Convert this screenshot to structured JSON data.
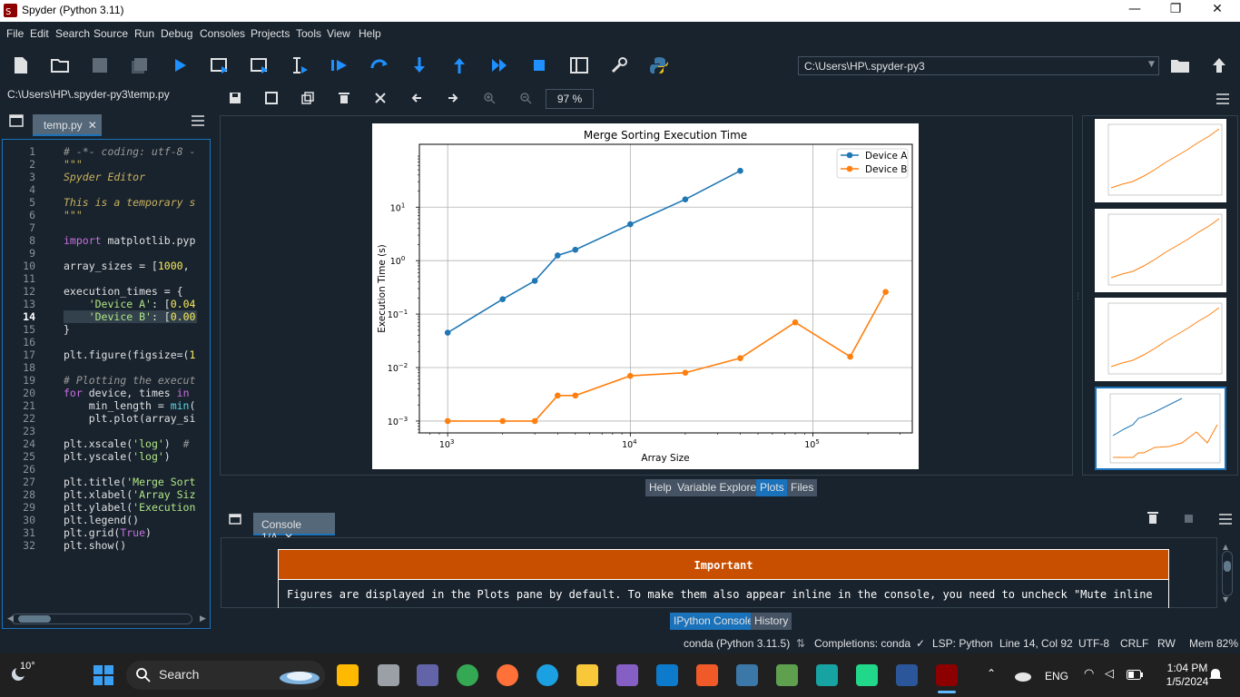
{
  "window": {
    "title": "Spyder (Python 3.11)"
  },
  "menu": [
    "File",
    "Edit",
    "Search",
    "Source",
    "Run",
    "Debug",
    "Consoles",
    "Projects",
    "Tools",
    "View",
    "Help"
  ],
  "toolbar": {
    "working_dir": "C:\\Users\\HP\\.spyder-py3"
  },
  "editor": {
    "path": "C:\\Users\\HP\\.spyder-py3\\temp.py",
    "tab": "temp.py",
    "current_line": 14,
    "lines": [
      "# -*- coding: utf-8 -",
      "\"\"\"",
      "Spyder Editor",
      "",
      "This is a temporary s",
      "\"\"\"",
      "",
      "import matplotlib.pyp",
      "",
      "array_sizes = [1000,",
      "",
      "execution_times = {",
      "    'Device A': [0.04",
      "    'Device B': [0.00",
      "}",
      "",
      "plt.figure(figsize=(1",
      "",
      "# Plotting the execut",
      "for device, times in",
      "    min_length = min(",
      "    plt.plot(array_si",
      "",
      "plt.xscale('log')  #",
      "plt.yscale('log')",
      "",
      "plt.title('Merge Sort",
      "plt.xlabel('Array Siz",
      "plt.ylabel('Execution",
      "plt.legend()",
      "plt.grid(True)",
      "plt.show()"
    ]
  },
  "plots": {
    "zoom": "97 %",
    "tabs": [
      "Help",
      "Variable Explorer",
      "Plots",
      "Files"
    ],
    "active_tab": "Plots"
  },
  "chart_data": {
    "type": "line",
    "title": "Merge Sorting Execution Time",
    "xlabel": "Array Size",
    "ylabel": "Execution Time (s)",
    "xscale": "log",
    "yscale": "log",
    "xlim": [
      700,
      350000
    ],
    "ylim": [
      0.0006,
      150
    ],
    "xticks": [
      {
        "v": 1000,
        "base": "10",
        "exp": "3"
      },
      {
        "v": 10000,
        "base": "10",
        "exp": "4"
      },
      {
        "v": 100000,
        "base": "10",
        "exp": "5"
      }
    ],
    "yticks": [
      {
        "v": 0.001,
        "base": "10",
        "exp": "−3"
      },
      {
        "v": 0.01,
        "base": "10",
        "exp": "−2"
      },
      {
        "v": 0.1,
        "base": "10",
        "exp": "−1"
      },
      {
        "v": 1,
        "base": "10",
        "exp": "0"
      },
      {
        "v": 10,
        "base": "10",
        "exp": "1"
      }
    ],
    "grid": true,
    "legend": "top-right",
    "series": [
      {
        "name": "Device A",
        "color": "#1f77b4",
        "x": [
          1000,
          2000,
          3000,
          4000,
          5000,
          10000,
          20000,
          40000
        ],
        "y": [
          0.045,
          0.19,
          0.42,
          1.25,
          1.6,
          4.8,
          14,
          48
        ]
      },
      {
        "name": "Device B",
        "color": "#ff7f0e",
        "x": [
          1000,
          2000,
          3000,
          4000,
          5000,
          10000,
          20000,
          40000,
          80000,
          160000,
          250000
        ],
        "y": [
          0.001,
          0.001,
          0.001,
          0.003,
          0.003,
          0.007,
          0.008,
          0.015,
          0.07,
          0.016,
          0.26
        ]
      }
    ]
  },
  "console": {
    "tab": "Console 1/A",
    "important_title": "Important",
    "important_msg": "Figures are displayed in the Plots pane by default. To make them also appear inline in the console, you need to uncheck \"Mute inline",
    "tabs": [
      "IPython Console",
      "History"
    ],
    "active_tab": "IPython Console"
  },
  "status": {
    "env": "conda (Python 3.11.5)",
    "completions": "Completions: conda",
    "lsp": "LSP: Python",
    "position": "Line 14, Col 92",
    "encoding": "UTF-8",
    "eol": "CRLF",
    "rw": "RW",
    "mem": "Mem 82%"
  },
  "taskbar": {
    "weather": "10°",
    "search": "Search",
    "lang": "ENG",
    "time": "1:04 PM",
    "date": "1/5/2024"
  }
}
